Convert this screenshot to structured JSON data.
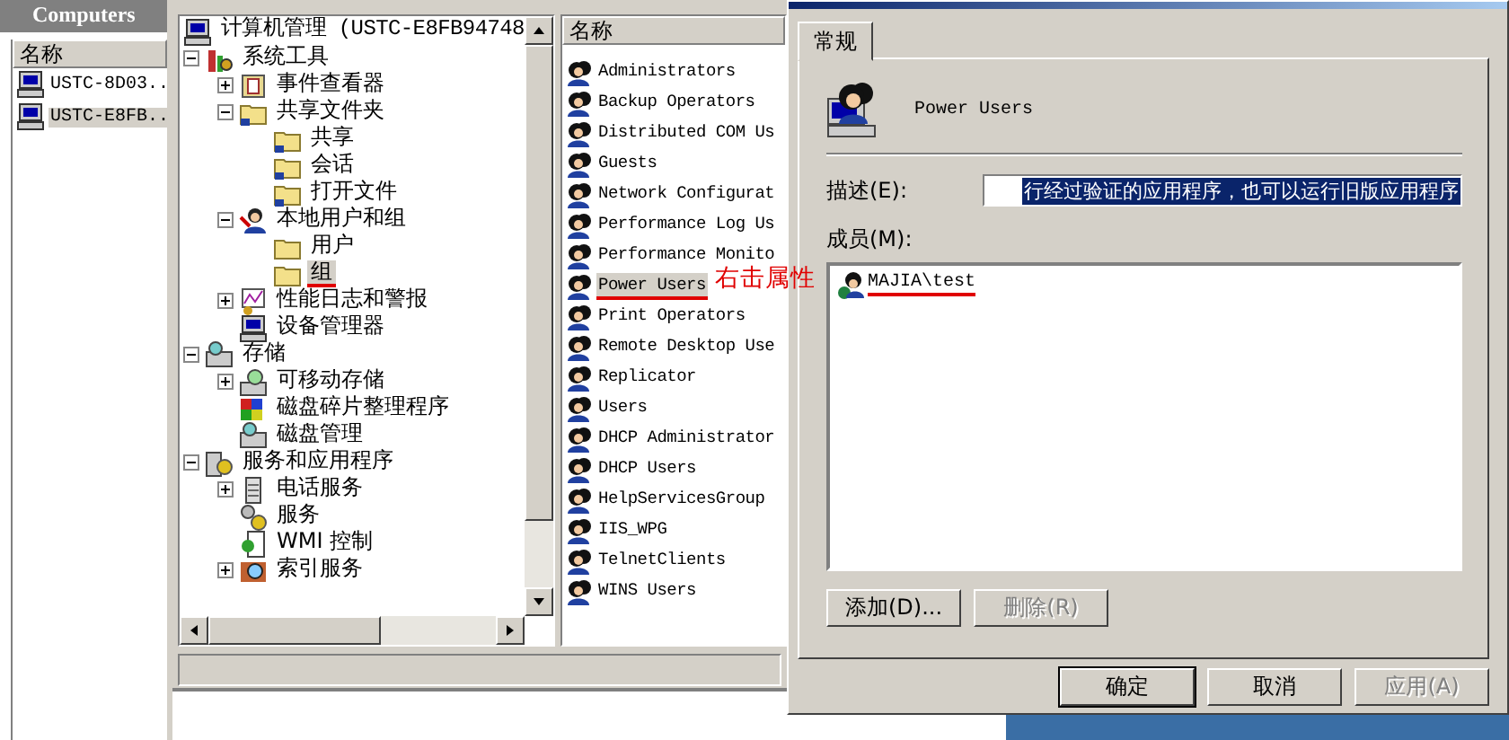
{
  "computers_panel": {
    "title": "Computers",
    "column": "名称",
    "items": [
      {
        "label": "USTC-8D03..",
        "selected": false
      },
      {
        "label": "USTC-E8FB..",
        "selected": true
      }
    ]
  },
  "tree": {
    "root": {
      "label": "计算机管理 (USTC-E8FB94748",
      "kind": "computer",
      "selected": false,
      "underlined": false,
      "children": [
        {
          "label": "系统工具",
          "kind": "tools",
          "expanded": true,
          "selected": false,
          "underlined": false,
          "children": [
            {
              "label": "事件查看器",
              "kind": "event",
              "expanded": false,
              "selected": false,
              "underlined": false
            },
            {
              "label": "共享文件夹",
              "kind": "share",
              "expanded": true,
              "selected": false,
              "underlined": false,
              "children": [
                {
                  "label": "共享",
                  "kind": "share",
                  "selected": false,
                  "underlined": false
                },
                {
                  "label": "会话",
                  "kind": "share",
                  "selected": false,
                  "underlined": false
                },
                {
                  "label": "打开文件",
                  "kind": "share",
                  "selected": false,
                  "underlined": false
                }
              ]
            },
            {
              "label": "本地用户和组",
              "kind": "users",
              "expanded": true,
              "selected": false,
              "underlined": false,
              "children": [
                {
                  "label": "用户",
                  "kind": "folder",
                  "selected": false,
                  "underlined": false
                },
                {
                  "label": "组",
                  "kind": "folder",
                  "selected": true,
                  "underlined": true
                }
              ]
            },
            {
              "label": "性能日志和警报",
              "kind": "perf",
              "expanded": false,
              "selected": false,
              "underlined": false
            },
            {
              "label": "设备管理器",
              "kind": "computer",
              "selected": false,
              "underlined": false
            }
          ]
        },
        {
          "label": "存储",
          "kind": "storage",
          "expanded": true,
          "selected": false,
          "underlined": false,
          "children": [
            {
              "label": "可移动存储",
              "kind": "disk",
              "expanded": false,
              "selected": false,
              "underlined": false
            },
            {
              "label": "磁盘碎片整理程序",
              "kind": "defrag",
              "selected": false,
              "underlined": false
            },
            {
              "label": "磁盘管理",
              "kind": "storage",
              "selected": false,
              "underlined": false
            }
          ]
        },
        {
          "label": "服务和应用程序",
          "kind": "services",
          "expanded": true,
          "selected": false,
          "underlined": false,
          "children": [
            {
              "label": "电话服务",
              "kind": "server",
              "expanded": false,
              "selected": false,
              "underlined": false
            },
            {
              "label": "服务",
              "kind": "gear",
              "selected": false,
              "underlined": false
            },
            {
              "label": "WMI 控制",
              "kind": "wmi",
              "selected": false,
              "underlined": false
            },
            {
              "label": "索引服务",
              "kind": "index",
              "expanded": false,
              "selected": false,
              "underlined": false
            }
          ]
        }
      ]
    }
  },
  "group_list": {
    "column": "名称",
    "items": [
      {
        "label": "Administrators",
        "selected": false,
        "underlined": false
      },
      {
        "label": "Backup Operators",
        "selected": false,
        "underlined": false
      },
      {
        "label": "Distributed COM Us",
        "selected": false,
        "underlined": false
      },
      {
        "label": "Guests",
        "selected": false,
        "underlined": false
      },
      {
        "label": "Network Configurat",
        "selected": false,
        "underlined": false
      },
      {
        "label": "Performance Log Us",
        "selected": false,
        "underlined": false
      },
      {
        "label": "Performance Monito",
        "selected": false,
        "underlined": false
      },
      {
        "label": "Power Users",
        "selected": true,
        "underlined": true
      },
      {
        "label": "Print Operators",
        "selected": false,
        "underlined": false
      },
      {
        "label": "Remote Desktop Use",
        "selected": false,
        "underlined": false
      },
      {
        "label": "Replicator",
        "selected": false,
        "underlined": false
      },
      {
        "label": "Users",
        "selected": false,
        "underlined": false
      },
      {
        "label": "DHCP Administrator",
        "selected": false,
        "underlined": false
      },
      {
        "label": "DHCP Users",
        "selected": false,
        "underlined": false
      },
      {
        "label": "HelpServicesGroup",
        "selected": false,
        "underlined": false
      },
      {
        "label": "IIS_WPG",
        "selected": false,
        "underlined": false
      },
      {
        "label": "TelnetClients",
        "selected": false,
        "underlined": false
      },
      {
        "label": "WINS Users",
        "selected": false,
        "underlined": false
      }
    ]
  },
  "annotation": {
    "text": "右击属性"
  },
  "dialog": {
    "tabs": [
      {
        "label": "常规",
        "selected": true
      }
    ],
    "group_name": "Power Users",
    "description": {
      "label": "描述(E):",
      "value": "行经过验证的应用程序，也可以运行旧版应用程序",
      "selected": true
    },
    "members": {
      "label": "成员(M):",
      "items": [
        {
          "label": "MAJIA\\test",
          "underlined": true
        }
      ]
    },
    "member_buttons": [
      {
        "label": "添加(D)...",
        "disabled": false
      },
      {
        "label": "删除(R)",
        "disabled": true
      }
    ],
    "buttons": [
      {
        "label": "确定",
        "default": true,
        "disabled": false
      },
      {
        "label": "取消",
        "default": false,
        "disabled": false
      },
      {
        "label": "应用(A)",
        "default": false,
        "disabled": true
      }
    ]
  }
}
